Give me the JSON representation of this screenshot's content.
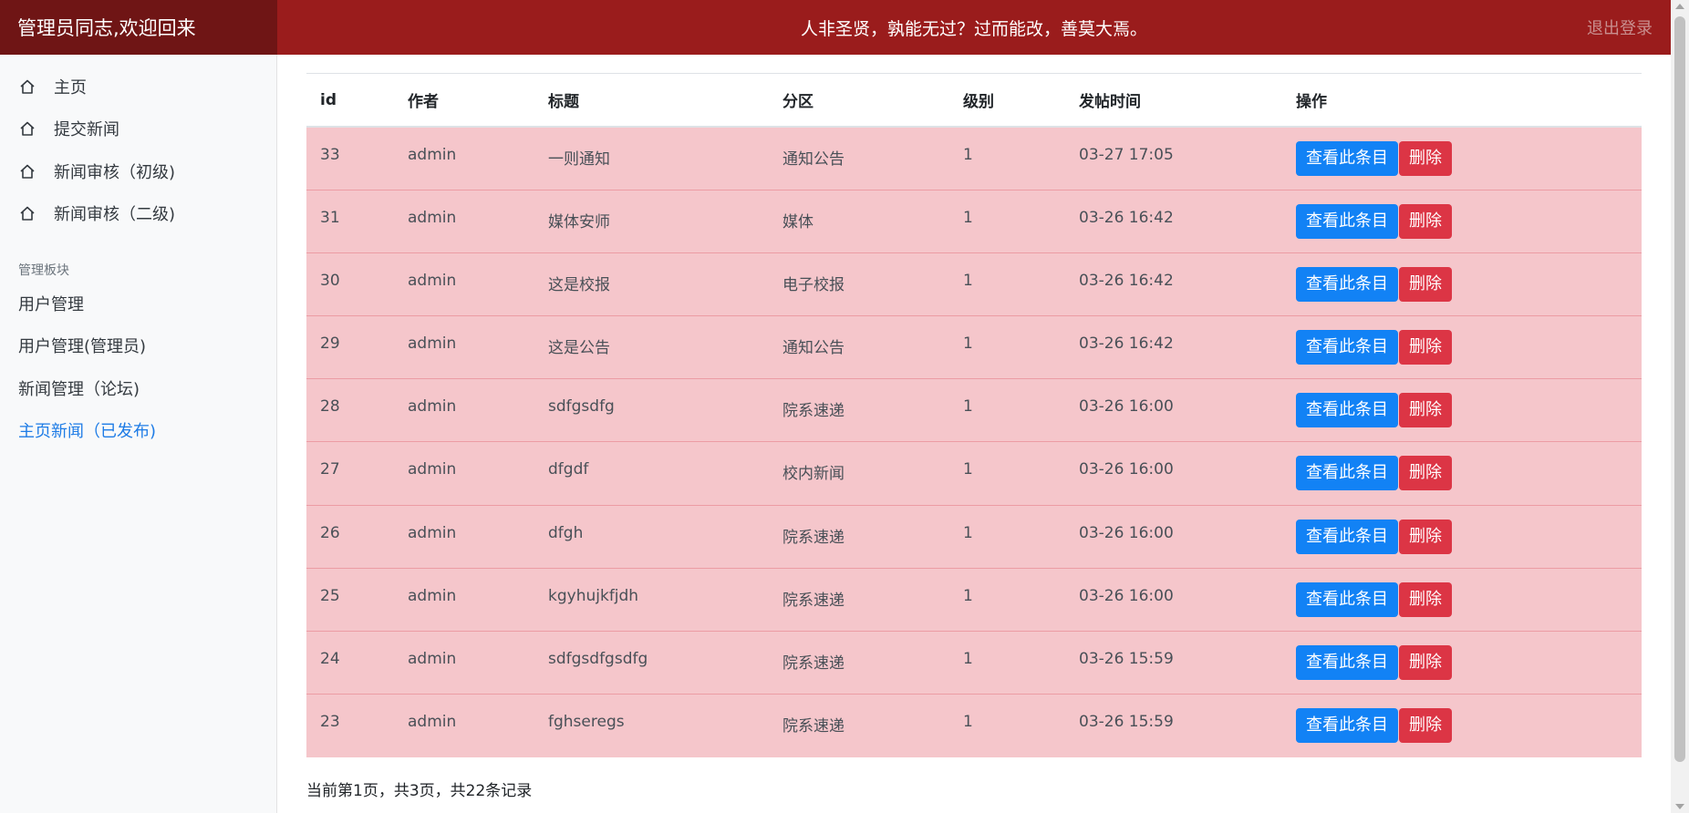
{
  "header": {
    "brand": "管理员同志,欢迎回来",
    "slogan": "人非圣贤，孰能无过？过而能改，善莫大焉。",
    "logout": "退出登录"
  },
  "sidebar": {
    "nav_items": [
      {
        "label": "主页",
        "icon": "home-icon"
      },
      {
        "label": "提交新闻",
        "icon": "home-icon"
      },
      {
        "label": "新闻审核（初级)",
        "icon": "home-icon"
      },
      {
        "label": "新闻审核（二级)",
        "icon": "home-icon"
      }
    ],
    "section_heading": "管理板块",
    "mgmt_items": [
      {
        "label": "用户管理"
      },
      {
        "label": "用户管理(管理员)"
      },
      {
        "label": "新闻管理（论坛)"
      },
      {
        "label": "主页新闻（已发布)",
        "active": true
      }
    ]
  },
  "table": {
    "headers": [
      "id",
      "作者",
      "标题",
      "分区",
      "级别",
      "发帖时间",
      "操作"
    ],
    "view_label": "查看此条目",
    "delete_label": "删除",
    "rows": [
      {
        "id": "33",
        "author": "admin",
        "title": "一则通知",
        "section": "通知公告",
        "level": "1",
        "time": "03-27 17:05"
      },
      {
        "id": "31",
        "author": "admin",
        "title": "媒体安师",
        "section": "媒体",
        "level": "1",
        "time": "03-26 16:42"
      },
      {
        "id": "30",
        "author": "admin",
        "title": "这是校报",
        "section": "电子校报",
        "level": "1",
        "time": "03-26 16:42"
      },
      {
        "id": "29",
        "author": "admin",
        "title": "这是公告",
        "section": "通知公告",
        "level": "1",
        "time": "03-26 16:42"
      },
      {
        "id": "28",
        "author": "admin",
        "title": "sdfgsdfg",
        "section": "院系速递",
        "level": "1",
        "time": "03-26 16:00"
      },
      {
        "id": "27",
        "author": "admin",
        "title": "dfgdf",
        "section": "校内新闻",
        "level": "1",
        "time": "03-26 16:00"
      },
      {
        "id": "26",
        "author": "admin",
        "title": "dfgh",
        "section": "院系速递",
        "level": "1",
        "time": "03-26 16:00"
      },
      {
        "id": "25",
        "author": "admin",
        "title": "kgyhujkfjdh",
        "section": "院系速递",
        "level": "1",
        "time": "03-26 16:00"
      },
      {
        "id": "24",
        "author": "admin",
        "title": "sdfgsdfgsdfg",
        "section": "院系速递",
        "level": "1",
        "time": "03-26 15:59"
      },
      {
        "id": "23",
        "author": "admin",
        "title": "fghseregs",
        "section": "院系速递",
        "level": "1",
        "time": "03-26 15:59"
      }
    ]
  },
  "pagination": {
    "text": "当前第1页，共3页，共22条记录"
  },
  "colors": {
    "header_bg": "#9a1c1c",
    "brand_bg": "#6f1515",
    "row_bg": "#f5c6cb",
    "view_button": "#1282f5",
    "delete_button": "#dc3545",
    "active_link": "#1e7ce6"
  }
}
